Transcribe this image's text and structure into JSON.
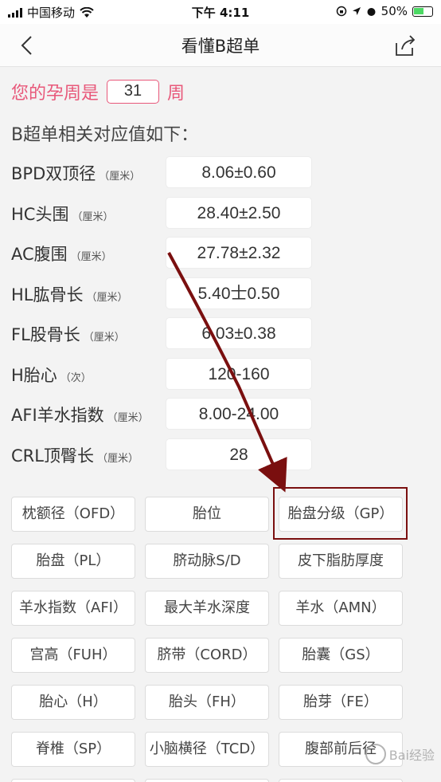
{
  "status_bar": {
    "carrier": "中国移动",
    "time": "下午 4:11",
    "battery": "50%"
  },
  "nav": {
    "title": "看懂B超单"
  },
  "pregnancy": {
    "prefix": "您的孕周是",
    "week": "31",
    "suffix": "周"
  },
  "section_title": "B超单相关对应值如下：",
  "metrics": [
    {
      "label": "BPD双顶径",
      "unit": "（厘米）",
      "value": "8.06±0.60"
    },
    {
      "label": "HC头围",
      "unit": "（厘米）",
      "value": "28.40±2.50"
    },
    {
      "label": "AC腹围",
      "unit": "（厘米）",
      "value": "27.78±2.32"
    },
    {
      "label": "HL肱骨长",
      "unit": "（厘米）",
      "value": "5.40士0.50"
    },
    {
      "label": "FL股骨长",
      "unit": "（厘米）",
      "value": "6.03±0.38"
    },
    {
      "label": "H胎心",
      "unit": "（次）",
      "value": "120-160"
    },
    {
      "label": "AFI羊水指数",
      "unit": "（厘米）",
      "value": "8.00-24.00"
    },
    {
      "label": "CRL顶臀长",
      "unit": "（厘米）",
      "value": "28"
    }
  ],
  "terms": [
    "枕额径（OFD）",
    "胎位",
    "胎盘分级（GP）",
    "胎盘（PL）",
    "脐动脉S/D",
    "皮下脂肪厚度",
    "羊水指数（AFI）",
    "最大羊水深度",
    "羊水（AMN）",
    "宫高（FUH）",
    "脐带（CORD）",
    "胎囊（GS）",
    "胎心（H）",
    "胎头（FH）",
    "胎芽（FE）",
    "脊椎（SP）",
    "小脑横径（TCD）",
    "腹部前后径"
  ],
  "watermark": "Bai经验",
  "colors": {
    "accent": "#e8587a",
    "annotation": "#7a0f0f"
  }
}
